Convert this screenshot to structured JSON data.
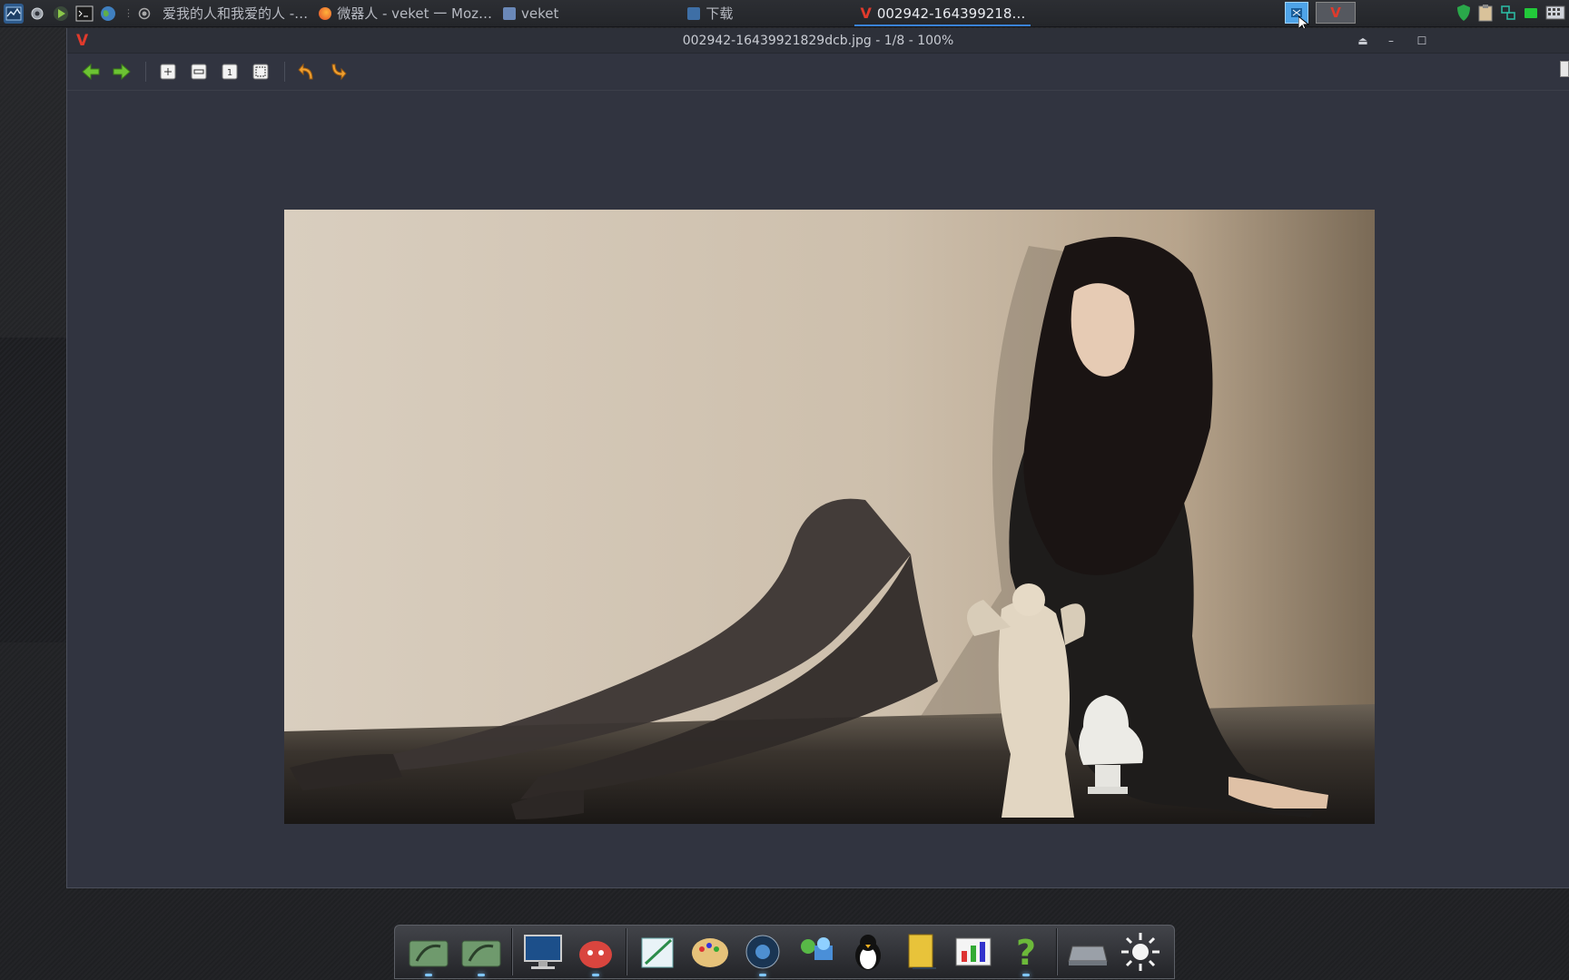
{
  "taskbar": {
    "launchers": [
      "system-monitor-icon",
      "settings-icon",
      "play-icon",
      "terminal-icon",
      "globe-icon"
    ],
    "tasks": [
      {
        "label": "爱我的人和我爱的人 -…"
      },
      {
        "label": "微器人 - veket 一 Moz…"
      },
      {
        "label": "veket"
      },
      {
        "label": "下载"
      },
      {
        "label": "002942-164399218…"
      }
    ]
  },
  "window": {
    "title": "002942-16439921829dcb.jpg - 1/8 - 100%",
    "buttons": {
      "eject": "⏏",
      "minimize": "–",
      "maximize": "☐"
    }
  },
  "toolbar": {
    "items": [
      "prev-arrow-icon",
      "next-arrow-icon",
      "zoom-in-icon",
      "zoom-out-icon",
      "actual-size-icon",
      "fit-window-icon",
      "rotate-left-icon",
      "rotate-right-icon"
    ]
  },
  "colors": {
    "accent": "#3a82d6",
    "window_bg": "#313440",
    "taskbar_bg": "#2a2c31"
  },
  "dock": {
    "icons": [
      "drive-icon",
      "drive-icon",
      "monitor-icon",
      "pet-icon",
      "notepad-icon",
      "paint-icon",
      "media-player-icon",
      "network-icon",
      "penguin-icon",
      "notebook-icon",
      "chart-icon",
      "help-icon",
      "disk-icon",
      "sun-icon"
    ]
  }
}
